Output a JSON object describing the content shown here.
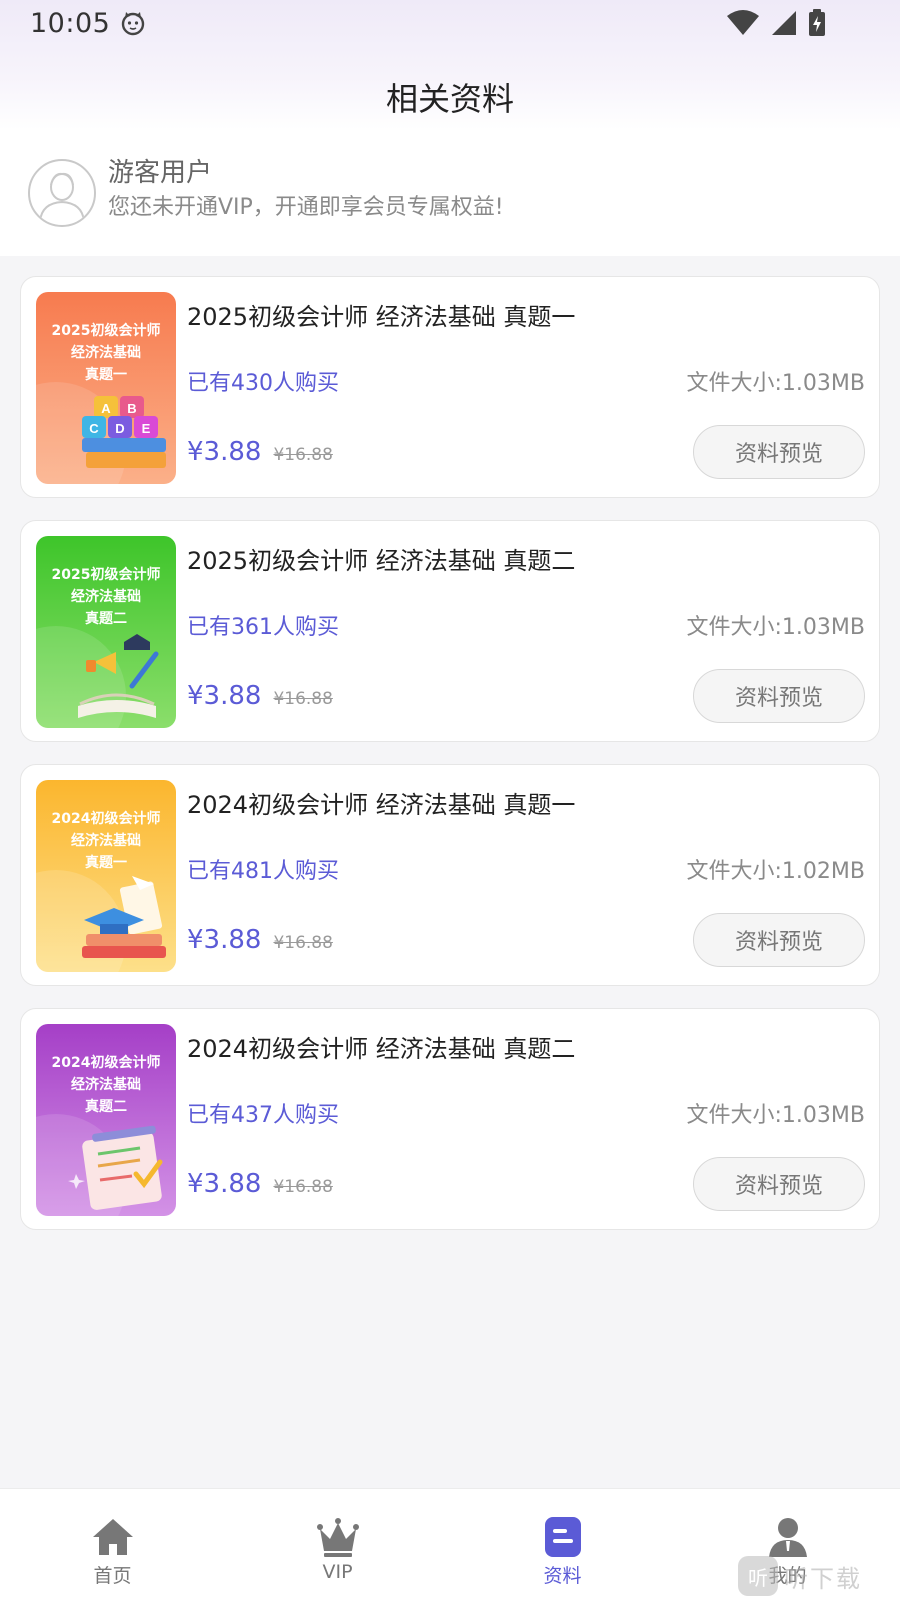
{
  "status_bar": {
    "time": "10:05"
  },
  "header": {
    "title": "相关资料"
  },
  "user": {
    "name": "游客用户",
    "desc": "您还未开通VIP，开通即享会员专属权益!"
  },
  "materials": [
    {
      "cover_lines": [
        "2025初级会计师",
        "经济法基础",
        "真题一"
      ],
      "cover_color_start": "#f77b4f",
      "cover_color_end": "#fbb089",
      "title": "2025初级会计师 经济法基础 真题一",
      "buyers": "已有430人购买",
      "file_size": "文件大小:1.03MB",
      "price": "¥3.88",
      "old_price": "¥16.88",
      "preview_label": "资料预览"
    },
    {
      "cover_lines": [
        "2025初级会计师",
        "经济法基础",
        "真题二"
      ],
      "cover_color_start": "#3ec52a",
      "cover_color_end": "#8bde6b",
      "title": "2025初级会计师 经济法基础 真题二",
      "buyers": "已有361人购买",
      "file_size": "文件大小:1.03MB",
      "price": "¥3.88",
      "old_price": "¥16.88",
      "preview_label": "资料预览"
    },
    {
      "cover_lines": [
        "2024初级会计师",
        "经济法基础",
        "真题一"
      ],
      "cover_color_start": "#fbb62e",
      "cover_color_end": "#fde08a",
      "title": "2024初级会计师 经济法基础 真题一",
      "buyers": "已有481人购买",
      "file_size": "文件大小:1.02MB",
      "price": "¥3.88",
      "old_price": "¥16.88",
      "preview_label": "资料预览"
    },
    {
      "cover_lines": [
        "2024初级会计师",
        "经济法基础",
        "真题二"
      ],
      "cover_color_start": "#a53fc7",
      "cover_color_end": "#d392e6",
      "title": "2024初级会计师 经济法基础 真题二",
      "buyers": "已有437人购买",
      "file_size": "文件大小:1.03MB",
      "price": "¥3.88",
      "old_price": "¥16.88",
      "preview_label": "资料预览"
    }
  ],
  "bottom_nav": [
    {
      "label": "首页",
      "icon": "home-icon",
      "active": false
    },
    {
      "label": "VIP",
      "icon": "crown-icon",
      "active": false
    },
    {
      "label": "资料",
      "icon": "document-icon",
      "active": true
    },
    {
      "label": "我的",
      "icon": "user-icon",
      "active": false
    }
  ],
  "watermark": {
    "badge": "听",
    "text": "听下载"
  },
  "colors": {
    "accent": "#5b5bd6",
    "background": "#f5f5f7"
  }
}
